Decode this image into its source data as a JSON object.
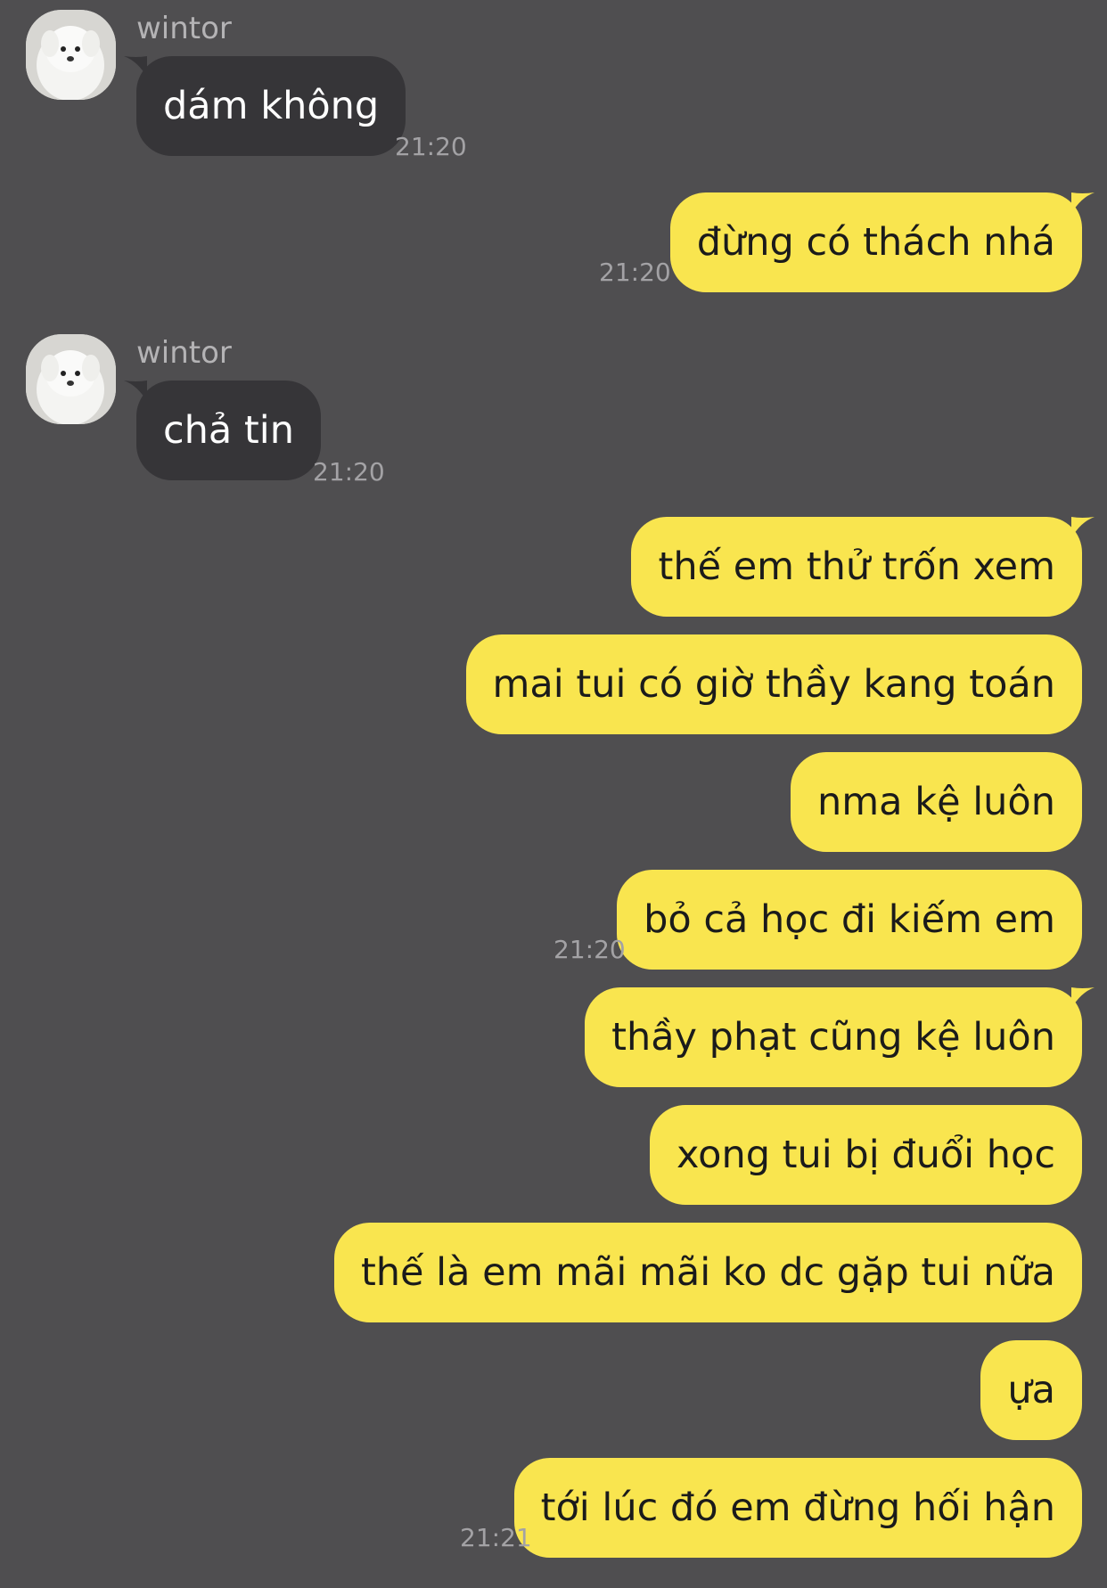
{
  "colors": {
    "background": "#4f4e50",
    "incoming_bubble": "#363538",
    "outgoing_bubble": "#f9e54f",
    "timestamp": "#a3a2a5"
  },
  "conversation": {
    "groups": [
      {
        "sender": "wintor",
        "avatar": "white-dog-avatar",
        "message": "dám không",
        "time": "21:20"
      },
      {
        "message": "đừng có thách nhá",
        "time": "21:20"
      },
      {
        "sender": "wintor",
        "avatar": "white-dog-avatar",
        "message": "chả tin",
        "time": "21:20"
      },
      {
        "messages": [
          "thế em thử trốn xem",
          "mai tui có giờ thầy kang toán",
          "nma kệ luôn",
          "bỏ cả học đi kiếm em"
        ],
        "time": "21:20"
      },
      {
        "messages": [
          "thầy phạt cũng kệ luôn",
          "xong tui bị đuổi học",
          "thế là em mãi mãi ko dc gặp tui nữa",
          "ựa",
          "tới lúc đó em đừng hối hận"
        ],
        "time": "21:21"
      }
    ]
  }
}
